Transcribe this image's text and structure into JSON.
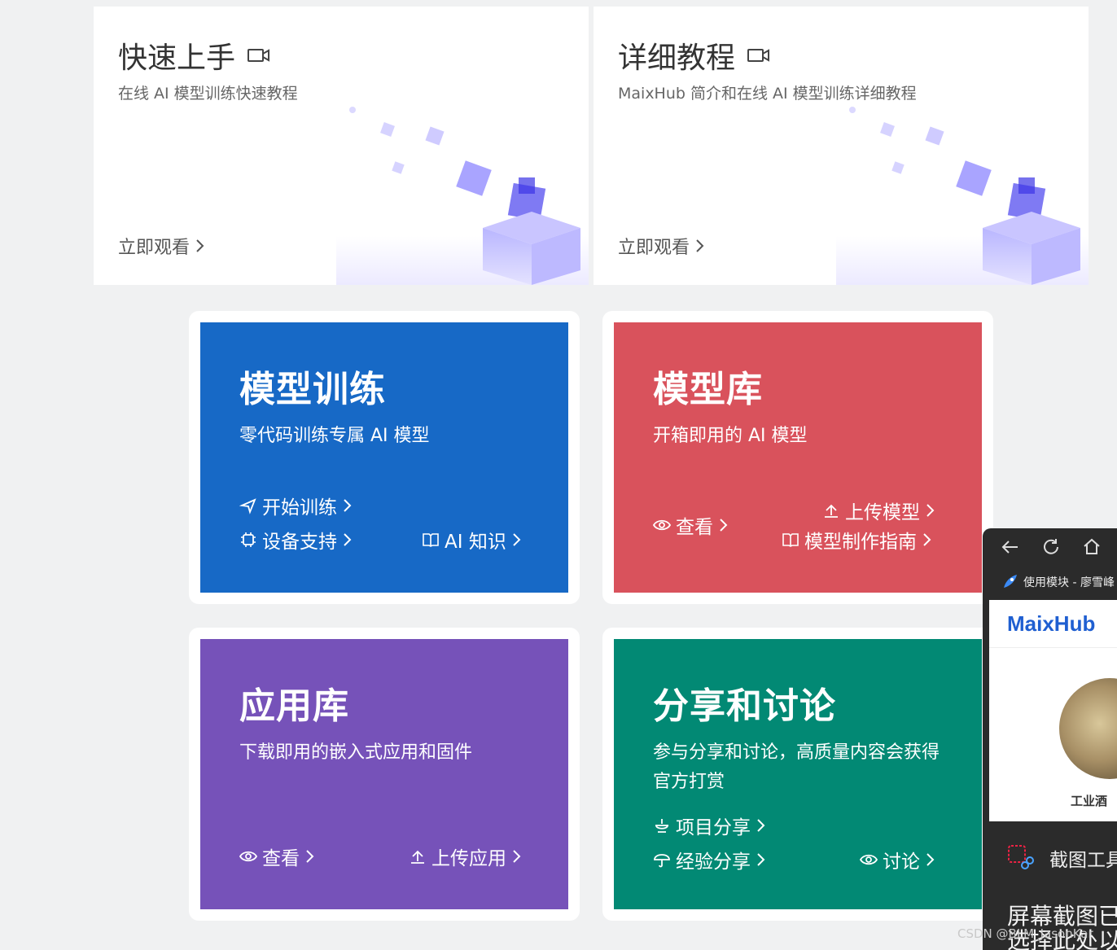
{
  "top_cards": [
    {
      "title": "快速上手",
      "subtitle": "在线 AI 模型训练快速教程",
      "link": "立即观看",
      "title_icon": "video-camera-icon"
    },
    {
      "title": "详细教程",
      "subtitle": "MaixHub 简介和在线 AI 模型训练详细教程",
      "link": "立即观看",
      "title_icon": "video-camera-icon"
    }
  ],
  "tiles": {
    "training": {
      "title": "模型训练",
      "subtitle": "零代码训练专属 AI 模型",
      "color": "#1769c6",
      "start": "开始训练",
      "devices": "设备支持",
      "knowledge": "AI 知识"
    },
    "model_lib": {
      "title": "模型库",
      "subtitle": "开箱即用的 AI 模型",
      "color": "#d9525c",
      "view": "查看",
      "upload": "上传模型",
      "guide": "模型制作指南"
    },
    "app_lib": {
      "title": "应用库",
      "subtitle": "下载即用的嵌入式应用和固件",
      "color": "#7652b9",
      "view": "查看",
      "upload": "上传应用"
    },
    "share": {
      "title": "分享和讨论",
      "subtitle": "参与分享和讨论，高质量内容会获得官方打赏",
      "color": "#028974",
      "project": "项目分享",
      "experience": "经验分享",
      "discuss": "讨论"
    }
  },
  "overlay": {
    "tab_title": "使用模块 - 廖雪峰",
    "logo": "MaixHub",
    "user_name": "工业酒",
    "tool_label": "截图工具",
    "screenshot_line1": "屏幕截图已",
    "screenshot_line2": "选择此处以"
  },
  "watermark": "CSDN @BLM_JasonKar"
}
